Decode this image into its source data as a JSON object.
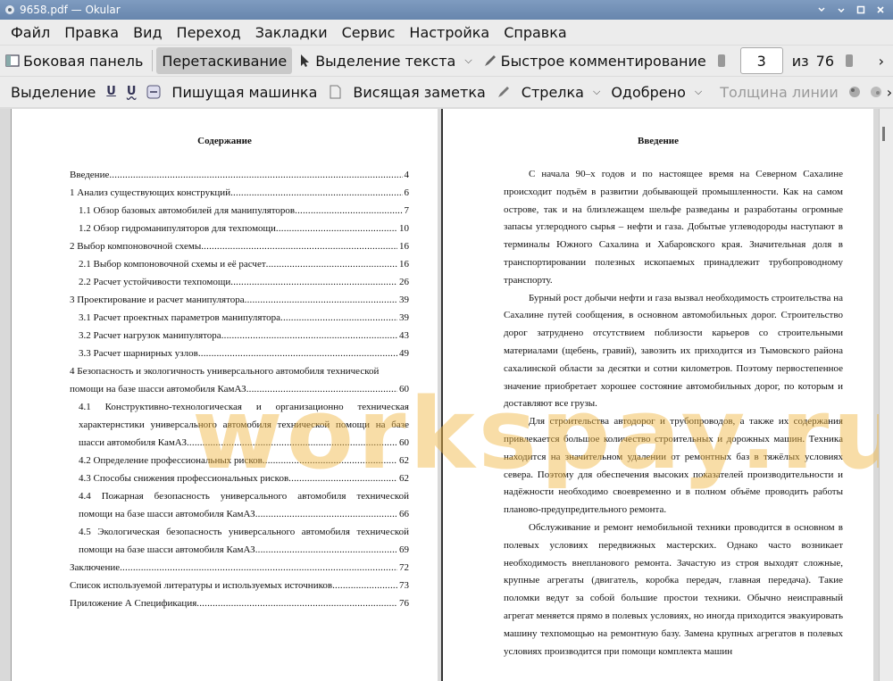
{
  "window": {
    "title": "9658.pdf  — Okular"
  },
  "menu": [
    "Файл",
    "Правка",
    "Вид",
    "Переход",
    "Закладки",
    "Сервис",
    "Настройка",
    "Справка"
  ],
  "toolbar1": {
    "sidebar": "Боковая панель",
    "drag": "Перетаскивание",
    "text_select": "Выделение текста",
    "quick_comment": "Быстрое комментирование",
    "page_current": "3",
    "page_of": "из",
    "page_total": "76"
  },
  "toolbar2": {
    "selection": "Выделение",
    "typewriter": "Пишущая машинка",
    "sticky_note": "Висящая заметка",
    "arrow": "Стрелка",
    "approved": "Одобрено",
    "line_width": "Толщина линии"
  },
  "left_page": {
    "title": "Содержание",
    "toc": [
      {
        "text": "Введение",
        "page": "4",
        "indent": false
      },
      {
        "text": "1 Анализ существующих конструкций",
        "page": "6",
        "indent": false
      },
      {
        "text": "1.1 Обзор базовых автомобилей для манипуляторов",
        "page": "7",
        "indent": true
      },
      {
        "text": "1.2 Обзор гидроманипуляторов для техпомощи",
        "page": "10",
        "indent": true
      },
      {
        "text": "2 Выбор компоновочной схемы",
        "page": "16",
        "indent": false
      },
      {
        "text": "2.1 Выбор компоновочной схемы и её расчет",
        "page": "16",
        "indent": true
      },
      {
        "text": "2.2 Расчет устойчивости техпомощи",
        "page": "26",
        "indent": true
      },
      {
        "text": "3 Проектирование и расчет манипулятора",
        "page": "39",
        "indent": false
      },
      {
        "text": "3.1 Расчет проектных параметров манипулятора",
        "page": "39",
        "indent": true
      },
      {
        "text": "3.2 Расчет нагрузок манипулятора",
        "page": "43",
        "indent": true
      },
      {
        "text": "3.3 Расчет шарнирных узлов",
        "page": "49",
        "indent": true
      }
    ],
    "toc4_first": "4 Безопасность и экологичность универсального автомобиля технической",
    "toc4_last": "помощи на базе шасси автомобиля КамАЗ",
    "toc4_page": "60",
    "toc41_l1": "4.1 Конструктивно-технологическая и организационно техническая",
    "toc41_l2": "характернстики универсального автомобиля технической помощи на базе",
    "toc41_last": "шасси автомобиля КамАЗ",
    "toc41_page": "60",
    "toc_rest": [
      {
        "text": "4.2 Определение профессиональных рисков",
        "page": "62"
      },
      {
        "text": "4.3 Способы снижения профессиональных рисков",
        "page": "62"
      }
    ],
    "toc44_l1": "4.4 Пожарная безопасность универсального автомобиля технической",
    "toc44_last": "помощи на базе шасси автомобиля КамАЗ",
    "toc44_page": "66",
    "toc45_l1": "4.5 Экологическая безопасность универсального автомобиля технической",
    "toc45_last": "помощи на базе шасси автомобиля КамАЗ",
    "toc45_page": "69",
    "toc_end": [
      {
        "text": "Заключение",
        "page": "72"
      },
      {
        "text": "Список используемой литературы и используемых источников",
        "page": "73"
      },
      {
        "text": "Приложение А Спецификация",
        "page": "76"
      }
    ]
  },
  "right_page": {
    "title": "Введение",
    "paragraphs": [
      "С начала 90–х годов и по настоящее время на Северном Сахалине происходит подъём в развитии добывающей промышленности. Как на самом острове, так и на близлежащем шельфе разведаны и разработаны огромные запасы углеродного сырья – нефти и газа. Добытые углеводороды наступают в терминалы Южного Сахалина и Хабаровского края. Значительная доля в транспортировании полезных ископаемых принадлежит трубопроводному транспорту.",
      "Бурный рост добычи нефти и газа вызвал необходимость строительства на Сахалине путей сообщения, в основном автомобильных дорог. Строительство дорог затруднено отсутствием поблизости карьеров со строительными материалами (щебень, гравий), завозить их приходится из Тымовского района сахалинской области за десятки и сотни километров. Поэтому первостепенное значение приобретает хорошее состояние автомобильных дорог, по которым и доставляют все грузы.",
      "Для строительства автодорог и трубопроводов, а также их содержания привлекается большое количество строительных и дорожных машин. Техника находится на значительном удалении от ремонтных баз в тяжёлых условиях севера. Поэтому для обеспечения высоких показателей производительности и надёжности необходимо своевременно и в полном объёме проводить работы планово-предупредительного ремонта.",
      "Обслуживание и ремонт немобильной техники проводится в основном в полевых условиях передвижных мастерских. Однако часто возникает необходимость внепланового ремонта. Зачастую из строя выходят сложные, крупные агрегаты (двигатель, коробка передач, главная передача). Такие поломки ведут за собой большие простои техники. Обычно неисправный агрегат меняется прямо в полевых условиях, но иногда приходится эвакуировать машину техпомощью на ремонтную базу. Замена крупных агрегатов в полевых условиях производится при помощи комплекта машин"
    ]
  },
  "watermark": "workspay.ru"
}
